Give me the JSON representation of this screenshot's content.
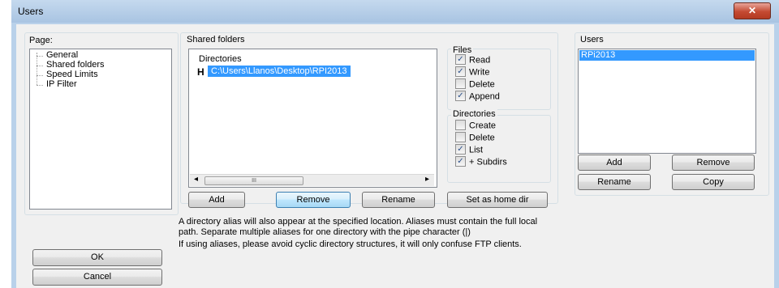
{
  "window": {
    "title": "Users",
    "close_glyph": "✕"
  },
  "page_panel": {
    "label": "Page:",
    "items": [
      "General",
      "Shared folders",
      "Speed Limits",
      "IP Filter"
    ]
  },
  "shared_folders": {
    "group_label": "Shared folders",
    "directories_header": "Directories",
    "home_marker": "H",
    "directory": "C:\\Users\\Llanos\\Desktop\\RPI2013",
    "scroll_left": "◂",
    "scroll_thumb": "III",
    "scroll_right": "▸",
    "buttons": {
      "add": "Add",
      "remove": "Remove",
      "rename": "Rename",
      "set_home": "Set as home dir"
    }
  },
  "files": {
    "label": "Files",
    "read": "Read",
    "write": "Write",
    "delete": "Delete",
    "append": "Append",
    "checked": {
      "read": true,
      "write": true,
      "delete": false,
      "append": true
    }
  },
  "directories_perm": {
    "label": "Directories",
    "create": "Create",
    "delete": "Delete",
    "list": "List",
    "subdirs": "+ Subdirs",
    "checked": {
      "create": false,
      "delete": false,
      "list": true,
      "subdirs": true
    }
  },
  "users": {
    "label": "Users",
    "items": [
      "RPi2013"
    ],
    "buttons": {
      "add": "Add",
      "remove": "Remove",
      "rename": "Rename",
      "copy": "Copy"
    }
  },
  "info": {
    "line1": "A directory alias will also appear at the specified location. Aliases must contain the full local",
    "line2": "path. Separate multiple aliases for one directory with the pipe character (|)",
    "line3": "If using aliases, please avoid cyclic directory structures, it will only confuse FTP clients."
  },
  "dialog_buttons": {
    "ok": "OK",
    "cancel": "Cancel"
  },
  "check_glyph": "✓"
}
